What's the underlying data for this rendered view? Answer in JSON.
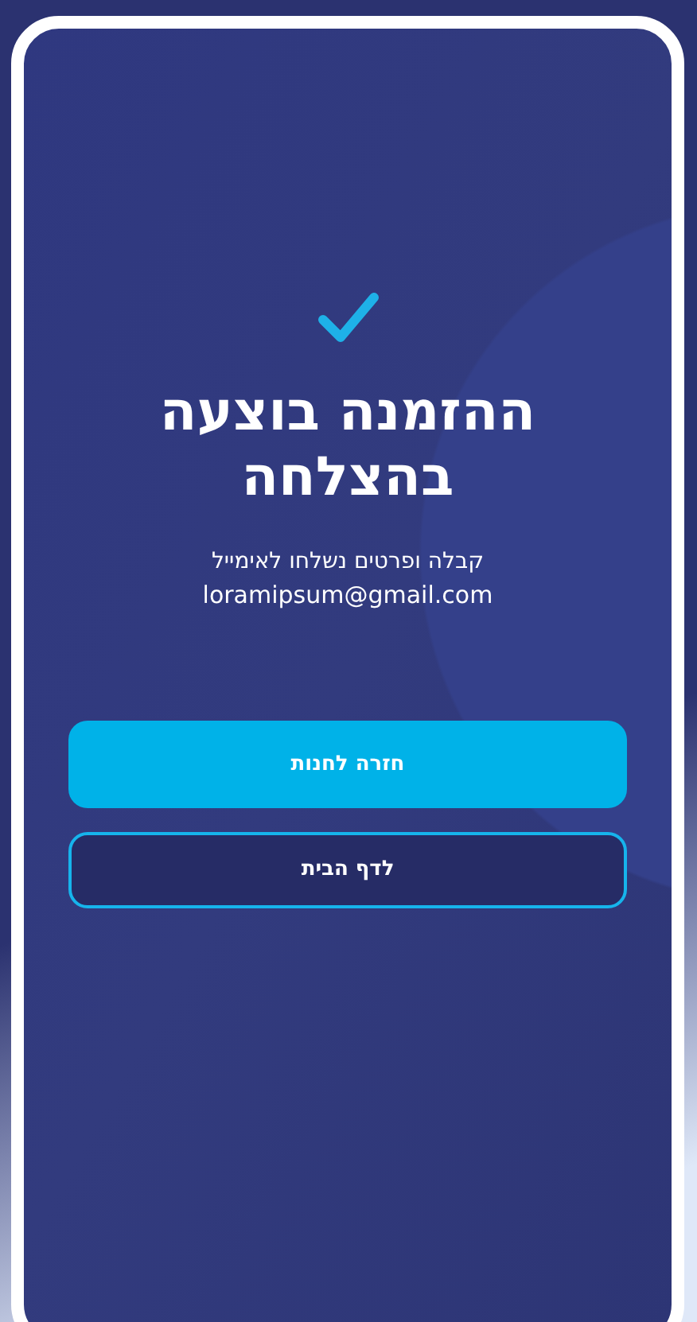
{
  "title": "ההזמנה בוצעה בהצלחה",
  "message": "קבלה ופרטים נשלחו לאימייל",
  "email": "loramipsum@gmail.com",
  "buttons": [
    {
      "label": "חזרה לחנות",
      "kind": "primary"
    },
    {
      "label": "לדף הבית",
      "kind": "outline"
    }
  ]
}
